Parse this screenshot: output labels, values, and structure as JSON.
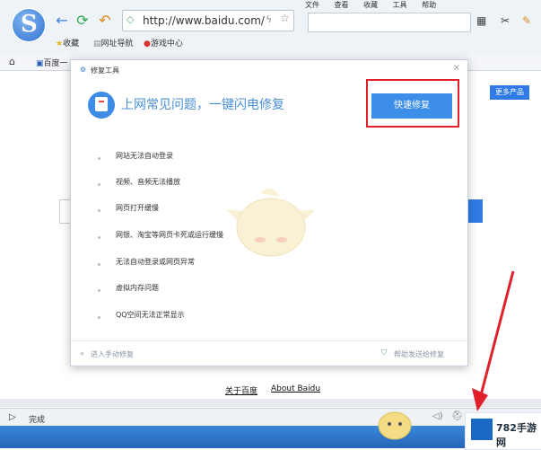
{
  "browser": {
    "url": "http://www.baidu.com/",
    "menu": [
      "文件",
      "查看",
      "收藏",
      "工具",
      "帮助"
    ],
    "bookmarks": [
      {
        "label": "收藏"
      },
      {
        "label": "网址导航"
      },
      {
        "label": "游戏中心"
      }
    ],
    "tab_label": "百度一"
  },
  "page": {
    "right_button": "更多产品",
    "link_about": "关于百度",
    "link_about_en": "About Baidu"
  },
  "status": {
    "text": "完成"
  },
  "dialog": {
    "title": "修复工具",
    "headline": "上网常见问题，一键闪电修复",
    "fix_button": "快速修复",
    "items": [
      "网站无法自动登录",
      "视频、音频无法播放",
      "网页打开缓慢",
      "网银、淘宝等网页卡死或运行缓慢",
      "无法自动登录或网页异常",
      "虚拟内存问题",
      "QQ空间无法正常显示"
    ],
    "footer_left": "进入手动修复",
    "footer_right": "帮助发送给修复"
  },
  "watermark": {
    "text": "782手游网"
  }
}
